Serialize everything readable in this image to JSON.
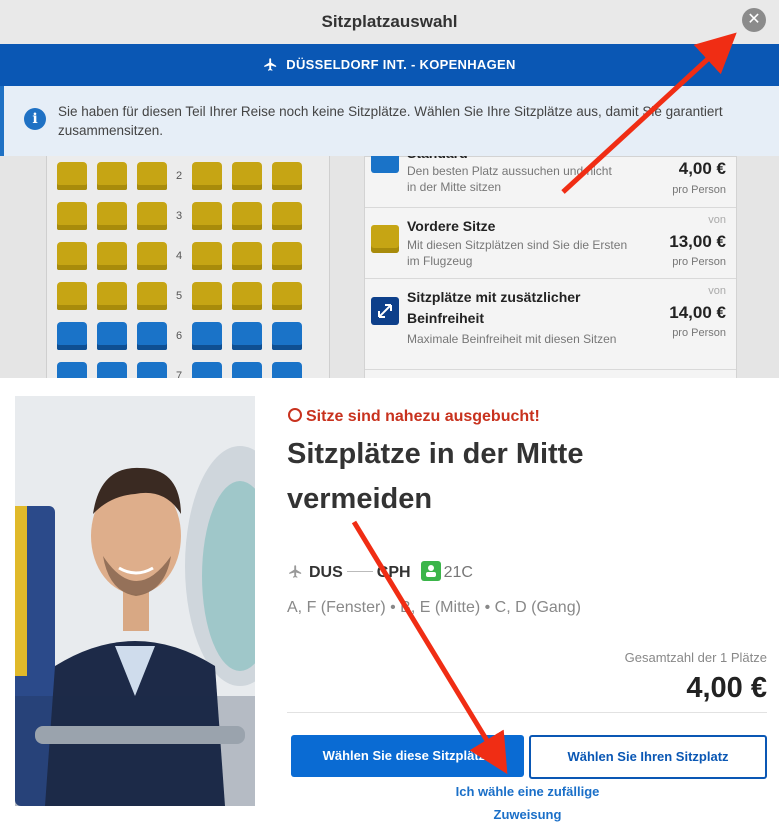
{
  "modal": {
    "title": "Sitzplatzauswahl",
    "close_icon": "close-icon",
    "route": "DÜSSELDORF INT. - KOPENHAGEN",
    "info_text": "Sie haben für diesen Teil Ihrer Reise noch keine Sitzplätze. Wählen Sie Ihre Sitzplätze aus, damit Sie garantiert zusammensitzen."
  },
  "seatmap": {
    "rows": [
      "2",
      "3",
      "4",
      "5",
      "6",
      "7"
    ],
    "colors": {
      "standard": "#1a73c8",
      "front": "#c6a514"
    }
  },
  "pricing": [
    {
      "name": "Standard",
      "desc": "Den besten Platz aussuchen und nicht in der Mitte sitzen",
      "from": "",
      "amount": "4,00 €",
      "per": "pro Person",
      "icon": "standard-seat-icon"
    },
    {
      "name": "Vordere Sitze",
      "desc": "Mit diesen Sitzplätzen sind Sie die Ersten im Flugzeug",
      "from": "von",
      "amount": "13,00 €",
      "per": "pro Person",
      "icon": "front-seat-icon"
    },
    {
      "name": "Sitzplätze mit zusätzlicher Beinfreiheit",
      "desc": "Maximale Beinfreiheit mit diesen Sitzen",
      "from": "von",
      "amount": "14,00 €",
      "per": "pro Person",
      "icon": "extra-legroom-icon"
    }
  ],
  "panel": {
    "warning": "Sitze sind nahezu ausgebucht!",
    "headline": "Sitzplätze in der Mitte vermeiden",
    "origin": "DUS",
    "destination": "CPH",
    "seat": "21C",
    "legend": "A, F (Fenster) • B, E (Mitte) • C, D (Gang)",
    "total_label": "Gesamtzahl der 1 Plätze",
    "total": "4,00 €",
    "btn_primary": "Wählen Sie diese Sitzplätze",
    "btn_secondary": "Wählen Sie Ihren Sitzplatz",
    "random_link": "Ich wähle eine zufällige Zuweisung"
  },
  "accent": {
    "blue": "#0a57b4",
    "red": "#c8321e",
    "green": "#3bb54a"
  }
}
